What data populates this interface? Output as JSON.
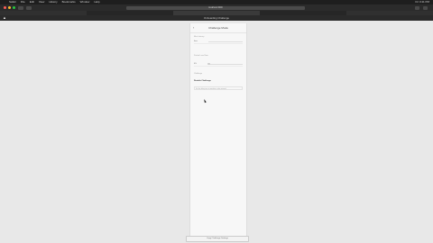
{
  "menubar": {
    "items": [
      "Safari",
      "File",
      "Edit",
      "View",
      "History",
      "Bookmarks",
      "Window",
      "Help"
    ],
    "status": "Fri 3:41 PM"
  },
  "browser": {
    "url": "localhost:3000",
    "window_title": "Onboarding Challenge"
  },
  "screen": {
    "title": "Challenge Mode",
    "back_icon": "chevron-left-icon",
    "section1_label": "Max Latency",
    "row1_value": "0ms",
    "section2_label": "Packet Loss Rate",
    "row2_value": "0%",
    "section3_label": "Challenge",
    "toggle_title": "Disable Challenge",
    "hint_placeholder": "Set the delay time to simulate a slow network"
  },
  "footer": {
    "label": "Copy Challenge Settings"
  },
  "colors": {
    "accent": "#2b2b2b"
  }
}
